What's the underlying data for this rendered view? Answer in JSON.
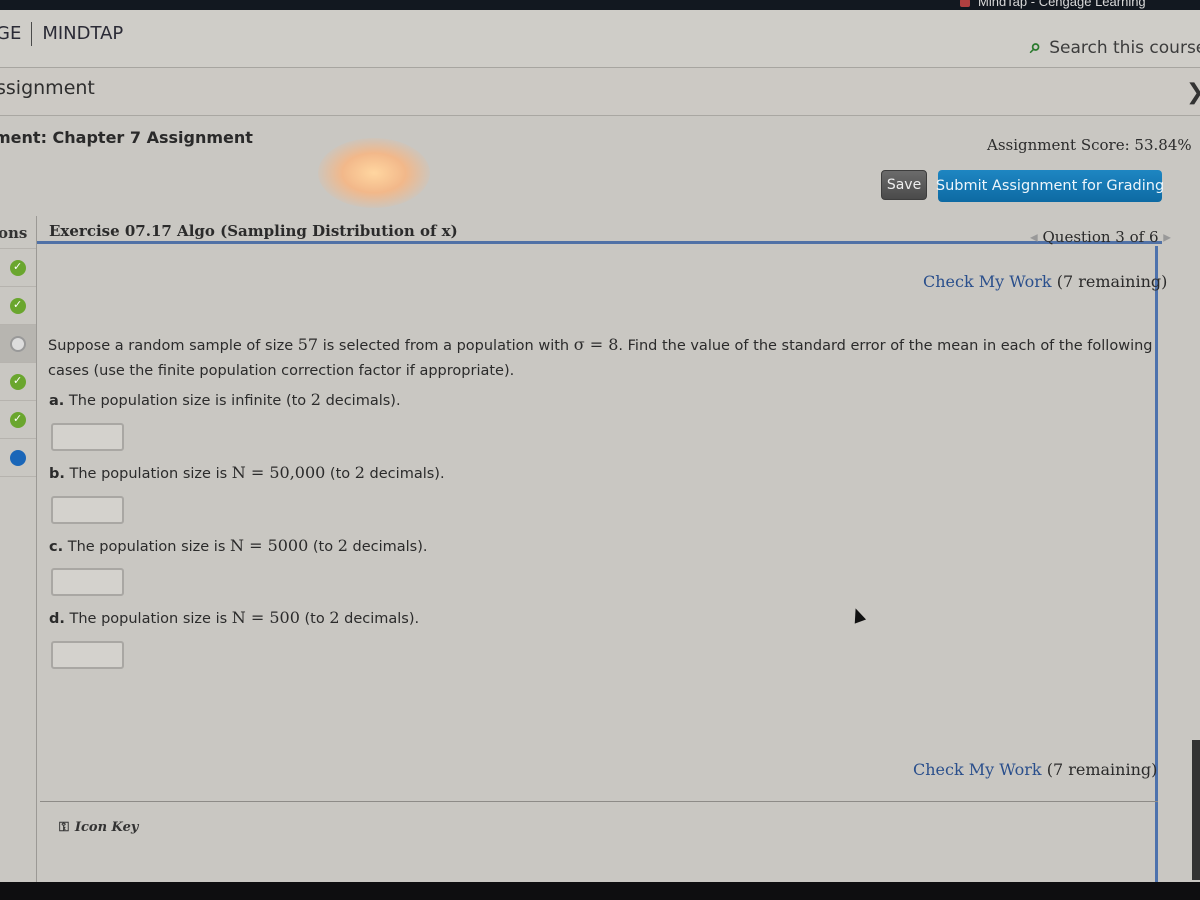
{
  "browser": {
    "tab_title": "MindTap - Cengage Learning"
  },
  "header": {
    "brand_left": "GE",
    "brand_product": "MINDTAP",
    "search_label": "Search this course"
  },
  "subheader": {
    "title": "ssignment"
  },
  "assignment": {
    "title": "ment: Chapter 7 Assignment",
    "score": "Assignment Score: 53.84%",
    "save_label": "Save",
    "submit_label": "Submit Assignment for Grading"
  },
  "sidebar": {
    "label": "ons",
    "questions": [
      {
        "status": "correct"
      },
      {
        "status": "correct"
      },
      {
        "status": "current"
      },
      {
        "status": "correct"
      },
      {
        "status": "correct"
      },
      {
        "status": "in-progress"
      }
    ]
  },
  "exercise": {
    "title": "Exercise 07.17 Algo (Sampling Distribution of x)",
    "question_nav": "Question 3 of 6",
    "check_link": "Check My Work",
    "check_remaining": "(7 remaining)",
    "prompt_part1": "Suppose a random sample of size ",
    "sample_size": "57",
    "prompt_part2": " is selected from a population with ",
    "sigma_expr": "σ = 8",
    "prompt_part3": ". Find the value of the standard error of the mean in each of the following cases (use the finite population correction factor if appropriate).",
    "parts": [
      {
        "letter": "a.",
        "text": " The population size is infinite (to ",
        "math": "",
        "decimals": "2",
        "tail": " decimals).",
        "value": ""
      },
      {
        "letter": "b.",
        "text": " The population size is ",
        "math": "N = 50,000",
        "decimals": "2",
        "tail": " decimals).",
        "value": ""
      },
      {
        "letter": "c.",
        "text": " The population size is ",
        "math": "N = 5000",
        "decimals": "2",
        "tail": " decimals).",
        "value": ""
      },
      {
        "letter": "d.",
        "text": " The population size is ",
        "math": "N = 500",
        "decimals": "2",
        "tail": " decimals).",
        "value": ""
      }
    ],
    "icon_key": "Icon Key"
  }
}
